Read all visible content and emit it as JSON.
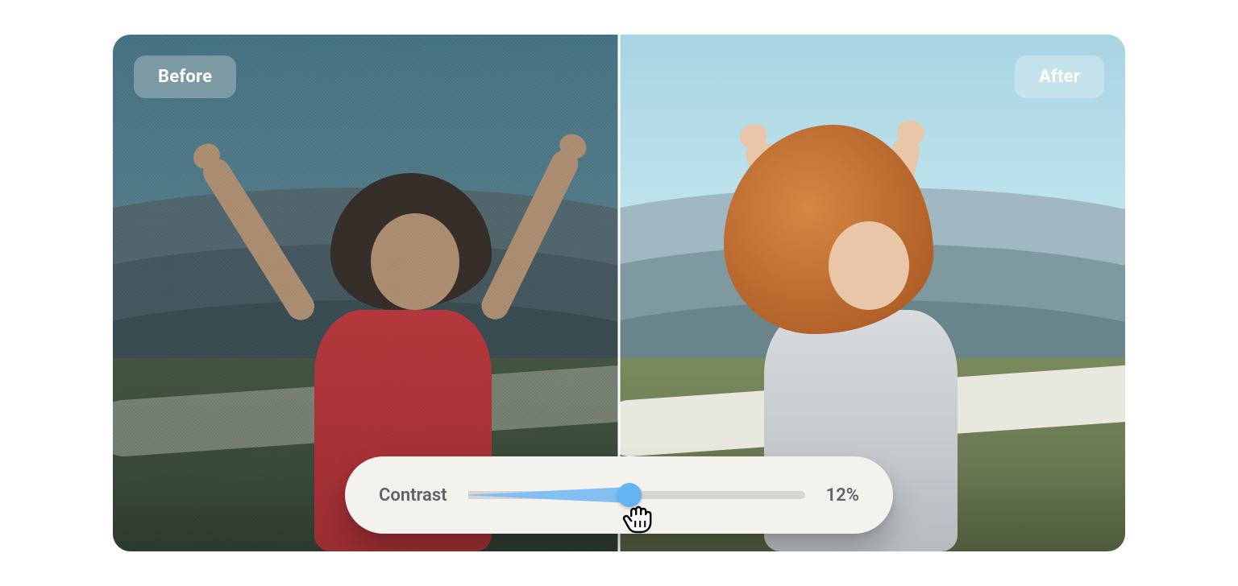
{
  "labels": {
    "before": "Before",
    "after": "After"
  },
  "slider": {
    "name": "Contrast",
    "value_text": "12%",
    "value": 12,
    "thumb_position_percent": 48
  },
  "compare": {
    "divider_position_percent": 50
  },
  "colors": {
    "accent": "#65b3f0",
    "accent_fill": "#83bff2",
    "panel_bg": "#f3f2ef",
    "text_muted": "#5f6265",
    "pill_bg": "rgba(255,255,255,0.28)"
  }
}
